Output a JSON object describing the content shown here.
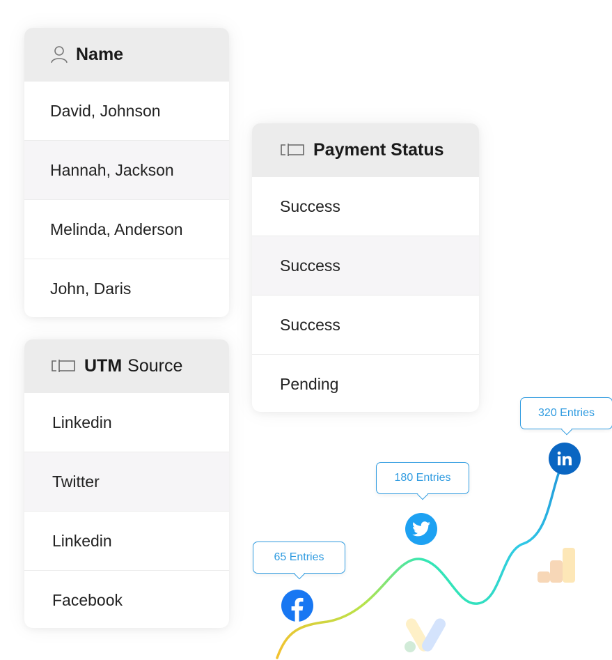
{
  "name_table": {
    "header": "Name",
    "icon": "user-icon",
    "rows": [
      "David, Johnson",
      "Hannah, Jackson",
      "Melinda, Anderson",
      "John, Daris"
    ]
  },
  "utm_table": {
    "header_bold": "UTM",
    "header_rest": "Source",
    "icon": "tag-icon",
    "rows": [
      "Linkedin",
      "Twitter",
      "Linkedin",
      "Facebook"
    ]
  },
  "payment_table": {
    "header": "Payment Status",
    "icon": "tag-icon",
    "rows": [
      "Success",
      "Success",
      "Success",
      "Pending"
    ]
  },
  "entries": {
    "facebook": "65 Entries",
    "twitter": "180 Entries",
    "linkedin": "320 Entries"
  },
  "icons": {
    "facebook": "facebook-icon",
    "twitter": "twitter-icon",
    "linkedin": "linkedin-icon",
    "analytics": "google-analytics-icon",
    "ads": "google-ads-icon"
  },
  "colors": {
    "accent": "#2f9be0",
    "facebook": "#1877f2",
    "twitter": "#1da1f2",
    "linkedin": "#0a66c2",
    "header_bg": "#ececec",
    "alt_row_bg": "#f6f5f7"
  }
}
